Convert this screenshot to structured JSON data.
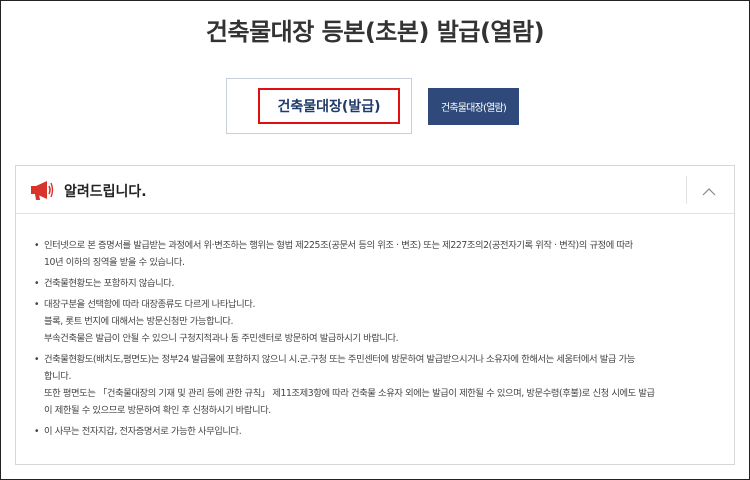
{
  "page": {
    "title": "건축물대장 등본(초본) 발급(열람)"
  },
  "tabs": {
    "issue_label": "건축물대장(발급)",
    "view_label": "건축물대장(열람)"
  },
  "notice": {
    "title": "알려드립니다.",
    "icon": "megaphone-icon",
    "collapse_icon": "chevron-up-icon",
    "bullet": "•",
    "items": [
      {
        "lines": [
          "인터넷으로 본 증명서를 발급받는 과정에서 위·변조하는 행위는 형법 제225조(공문서 등의 위조 · 변조) 또는 제227조의2(공전자기록 위작 · 변작)의 규정에 따라",
          "10년 이하의 징역을 받을 수 있습니다."
        ]
      },
      {
        "lines": [
          "건축물현황도는 포함하지 않습니다."
        ]
      },
      {
        "lines": [
          "대장구분을 선택함에 따라 대장종류도 다르게 나타납니다.",
          "블록, 롯트 번지에 대해서는 방문신청만 가능합니다.",
          "부속건축물은 발급이 안될 수 있으니 구청지적과나 동 주민센터로 방문하여 발급하시기 바랍니다."
        ]
      },
      {
        "lines": [
          "건축물현황도(배치도,평면도)는 정부24 발급물에 포함하지 않으니 시.군.구청 또는 주민센터에 방문하여 발급받으시거나 소유자에 한해서는 세움터에서 발급 가능",
          "합니다.",
          "또한 평면도는 「건축물대장의 기재 및 관리 등에 관한 규칙」 제11조제3항에 따라 건축물 소유자 외에는 발급이 제한될 수 있으며, 방문수령(후불)로 신청 시에도 발급",
          "이 제한될 수 있으므로 방문하여 확인 후 신청하시기 바랍니다."
        ]
      },
      {
        "lines": [
          "이 사무는 전자지갑, 전자증명서로 가능한 사무입니다."
        ]
      }
    ]
  },
  "colors": {
    "tab_active_text": "#1f3a6b",
    "tab_inactive_bg": "#2f4a7a",
    "highlight_border": "#e01010",
    "megaphone_accent": "#d9342b"
  }
}
